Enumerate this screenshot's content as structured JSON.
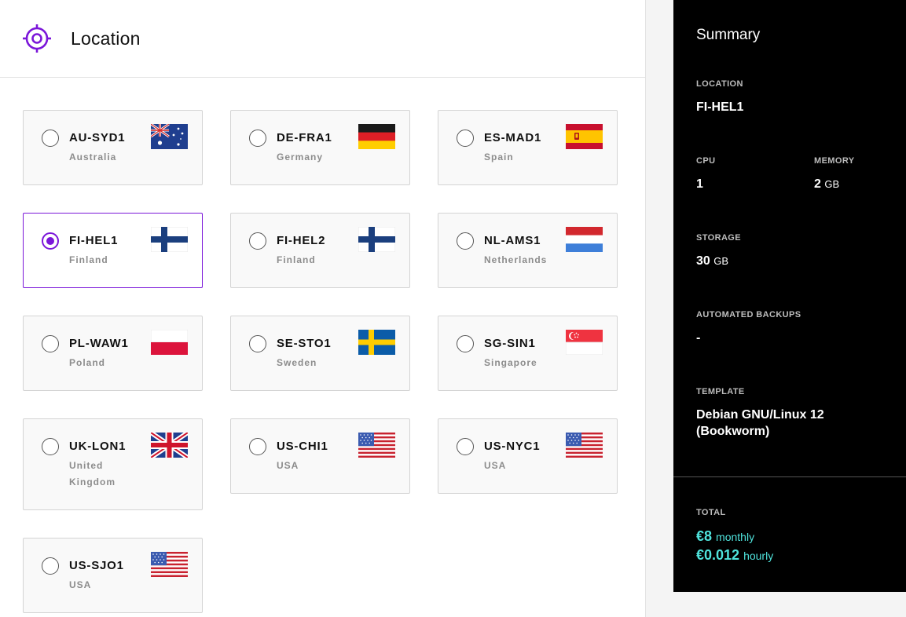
{
  "location_panel": {
    "title": "Location",
    "icon": "crosshair-icon",
    "accent_color": "#7b16d9",
    "regions": [
      {
        "code": "AU-SYD1",
        "country": "Australia",
        "flag": "au",
        "selected": false
      },
      {
        "code": "DE-FRA1",
        "country": "Germany",
        "flag": "de",
        "selected": false
      },
      {
        "code": "ES-MAD1",
        "country": "Spain",
        "flag": "es",
        "selected": false
      },
      {
        "code": "FI-HEL1",
        "country": "Finland",
        "flag": "fi",
        "selected": true
      },
      {
        "code": "FI-HEL2",
        "country": "Finland",
        "flag": "fi",
        "selected": false
      },
      {
        "code": "NL-AMS1",
        "country": "Netherlands",
        "flag": "nl",
        "selected": false
      },
      {
        "code": "PL-WAW1",
        "country": "Poland",
        "flag": "pl",
        "selected": false
      },
      {
        "code": "SE-STO1",
        "country": "Sweden",
        "flag": "se",
        "selected": false
      },
      {
        "code": "SG-SIN1",
        "country": "Singapore",
        "flag": "sg",
        "selected": false
      },
      {
        "code": "UK-LON1",
        "country": "United Kingdom",
        "flag": "uk",
        "selected": false
      },
      {
        "code": "US-CHI1",
        "country": "USA",
        "flag": "us",
        "selected": false
      },
      {
        "code": "US-NYC1",
        "country": "USA",
        "flag": "us",
        "selected": false
      },
      {
        "code": "US-SJO1",
        "country": "USA",
        "flag": "us",
        "selected": false
      }
    ]
  },
  "summary": {
    "title": "Summary",
    "location": {
      "label": "LOCATION",
      "value": "FI-HEL1"
    },
    "cpu": {
      "label": "CPU",
      "value": "1"
    },
    "memory": {
      "label": "MEMORY",
      "value": "2",
      "unit": "GB"
    },
    "storage": {
      "label": "STORAGE",
      "value": "30",
      "unit": "GB"
    },
    "backups": {
      "label": "AUTOMATED BACKUPS",
      "value": "-"
    },
    "template": {
      "label": "TEMPLATE",
      "value_line1": "Debian GNU/Linux 12",
      "value_line2": "(Bookworm)"
    },
    "total": {
      "label": "TOTAL",
      "monthly_price": "€8",
      "monthly_unit": "monthly",
      "hourly_price": "€0.012",
      "hourly_unit": "hourly"
    },
    "price_color": "#4fe3dc"
  }
}
